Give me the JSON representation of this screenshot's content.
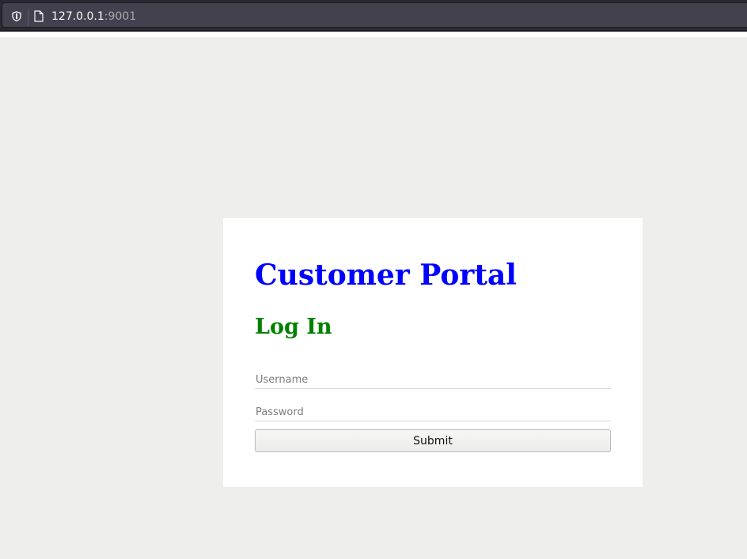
{
  "browser": {
    "url_host": "127.0.0.1",
    "url_port": ":9001",
    "icons": [
      "shield-icon",
      "page-icon"
    ]
  },
  "login": {
    "portal_title": "Customer Portal",
    "heading": "Log In",
    "username_placeholder": "Username",
    "password_placeholder": "Password",
    "submit_label": "Submit"
  },
  "colors": {
    "title": "#0000ff",
    "heading": "#008000",
    "page_background": "#eeeeec",
    "card_background": "#ffffff"
  }
}
